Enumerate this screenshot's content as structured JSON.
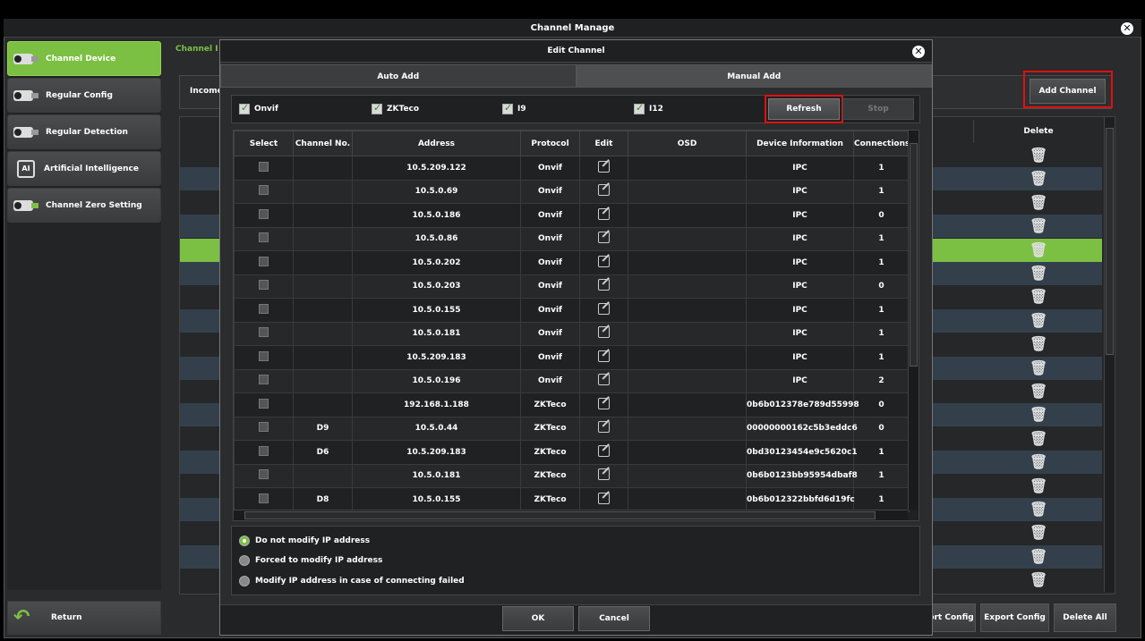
{
  "window": {
    "title": "Channel Manage"
  },
  "sidebar": {
    "items": [
      {
        "label": "Channel Device",
        "icon": "camera-icon"
      },
      {
        "label": "Regular Config",
        "icon": "camera-icon"
      },
      {
        "label": "Regular Detection",
        "icon": "camera-icon"
      },
      {
        "label": "Artificial Intelligence",
        "icon": "ai-icon"
      },
      {
        "label": "Channel Zero Setting",
        "icon": "camera-zero-icon"
      }
    ],
    "return_label": "Return"
  },
  "background": {
    "tab_label": "Channel I",
    "income_label": "Income",
    "add_channel_label": "Add Channel",
    "delete_header": "Delete",
    "import_label": "ort Config",
    "export_label": "Export Config",
    "delete_all_label": "Delete All",
    "accent": "#7cc043"
  },
  "dialog": {
    "title": "Edit Channel",
    "tabs": [
      "Auto Add",
      "Manual Add"
    ],
    "protocols": [
      "Onvif",
      "ZKTeco",
      "I9",
      "I12"
    ],
    "refresh_label": "Refresh",
    "stop_label": "Stop",
    "columns": [
      "Select",
      "Channel No.",
      "Address",
      "Protocol",
      "Edit",
      "OSD",
      "Device Information",
      "Connections"
    ],
    "rows": [
      {
        "channel": "",
        "address": "10.5.209.122",
        "protocol": "Onvif",
        "osd": "",
        "device": "IPC",
        "connections": "1"
      },
      {
        "channel": "",
        "address": "10.5.0.69",
        "protocol": "Onvif",
        "osd": "",
        "device": "IPC",
        "connections": "1"
      },
      {
        "channel": "",
        "address": "10.5.0.186",
        "protocol": "Onvif",
        "osd": "",
        "device": "IPC",
        "connections": "0"
      },
      {
        "channel": "",
        "address": "10.5.0.86",
        "protocol": "Onvif",
        "osd": "",
        "device": "IPC",
        "connections": "1"
      },
      {
        "channel": "",
        "address": "10.5.0.202",
        "protocol": "Onvif",
        "osd": "",
        "device": "IPC",
        "connections": "1"
      },
      {
        "channel": "",
        "address": "10.5.0.203",
        "protocol": "Onvif",
        "osd": "",
        "device": "IPC",
        "connections": "0"
      },
      {
        "channel": "",
        "address": "10.5.0.155",
        "protocol": "Onvif",
        "osd": "",
        "device": "IPC",
        "connections": "1"
      },
      {
        "channel": "",
        "address": "10.5.0.181",
        "protocol": "Onvif",
        "osd": "",
        "device": "IPC",
        "connections": "1"
      },
      {
        "channel": "",
        "address": "10.5.209.183",
        "protocol": "Onvif",
        "osd": "",
        "device": "IPC",
        "connections": "1"
      },
      {
        "channel": "",
        "address": "10.5.0.196",
        "protocol": "Onvif",
        "osd": "",
        "device": "IPC",
        "connections": "2"
      },
      {
        "channel": "",
        "address": "192.168.1.188",
        "protocol": "ZKTeco",
        "osd": "",
        "device": "0b6b012378e789d55998",
        "connections": "0"
      },
      {
        "channel": "D9",
        "address": "10.5.0.44",
        "protocol": "ZKTeco",
        "osd": "",
        "device": "00000000162c5b3eddc6",
        "connections": "0"
      },
      {
        "channel": "D6",
        "address": "10.5.209.183",
        "protocol": "ZKTeco",
        "osd": "",
        "device": "0bd30123454e9c5620c1",
        "connections": "1"
      },
      {
        "channel": "",
        "address": "10.5.0.181",
        "protocol": "ZKTeco",
        "osd": "",
        "device": "0b6b0123bb95954dbaf8",
        "connections": "1"
      },
      {
        "channel": "D8",
        "address": "10.5.0.155",
        "protocol": "ZKTeco",
        "osd": "",
        "device": "0b6b012322bbfd6d19fc",
        "connections": "1"
      }
    ],
    "ip_options": [
      "Do not modify IP address",
      "Forced to modify IP address",
      "Modify IP address in case of connecting failed"
    ],
    "selected_ip_option": 0,
    "ok_label": "OK",
    "cancel_label": "Cancel"
  }
}
